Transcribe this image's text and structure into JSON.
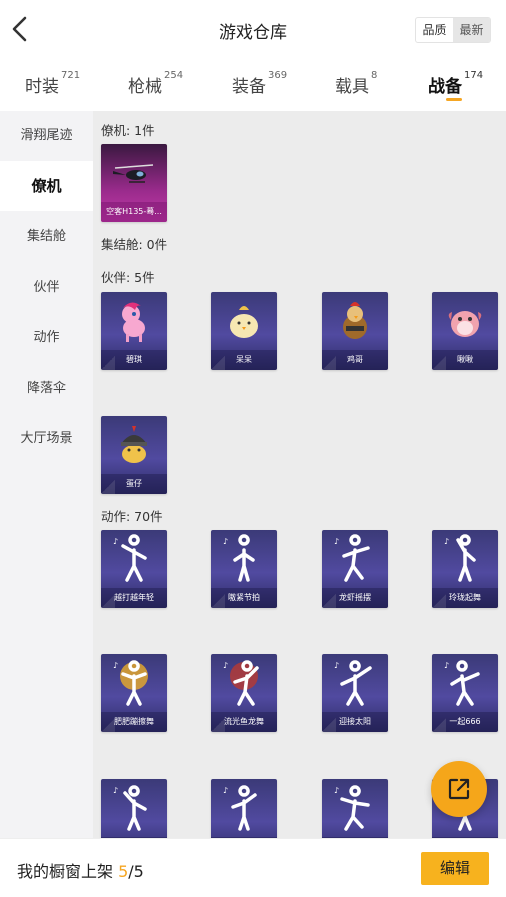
{
  "header": {
    "title": "游戏仓库",
    "sort_options": [
      "品质",
      "最新"
    ],
    "active_sort": "最新"
  },
  "tabs": [
    {
      "label": "时装",
      "count": "721"
    },
    {
      "label": "枪械",
      "count": "254"
    },
    {
      "label": "装备",
      "count": "369"
    },
    {
      "label": "载具",
      "count": "8"
    },
    {
      "label": "战备",
      "count": "174",
      "active": true
    }
  ],
  "sidebar": {
    "items": [
      "滑翔尾迹",
      "僚机",
      "集结舱",
      "伙伴",
      "动作",
      "降落伞",
      "大厅场景"
    ],
    "active": "僚机"
  },
  "sections": {
    "wingman": {
      "title": "僚机: 1件",
      "items": [
        "空客H135-蓦..."
      ]
    },
    "assembly": {
      "title": "集结舱: 0件"
    },
    "partner": {
      "title": "伙伴: 5件",
      "items": [
        "碧琪",
        "呆呆",
        "鸡哥",
        "啾啾",
        "蛋仔"
      ]
    },
    "action": {
      "title": "动作: 70件",
      "items": [
        "越打越年轻",
        "嗷紧节拍",
        "龙虾摇摆",
        "玲珑起舞",
        "肥肥蹦擦舞",
        "流光鱼龙舞",
        "迎接太阳",
        "一起666",
        "",
        "",
        "",
        ""
      ]
    }
  },
  "footer": {
    "text_prefix": "我的橱窗上架 ",
    "count_highlight": "5",
    "count_total": "/5",
    "edit_label": "编辑"
  },
  "colors": {
    "accent": "#f5a623",
    "fab": "#f5a61a",
    "card_purple": "#4a4494",
    "card_pink": "#b2349e"
  },
  "icons": {
    "back": "chevron-left-icon",
    "fab": "share-out-icon"
  }
}
